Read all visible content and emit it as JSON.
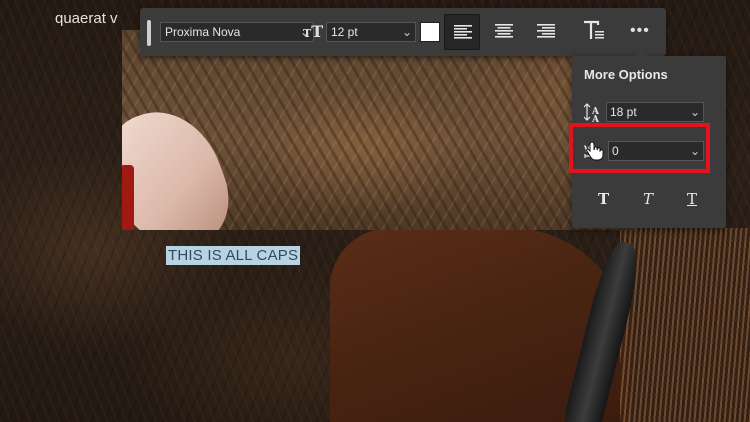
{
  "background": {
    "text_fragment": "quaerat v"
  },
  "canvas": {
    "selected_text": "THIS IS ALL CAPS"
  },
  "toolbar": {
    "font_family": "Proxima Nova",
    "font_size": "12 pt",
    "text_color": "#ffffff",
    "align_left_icon": "align-left-icon",
    "align_center_icon": "align-center-icon",
    "align_right_icon": "align-right-icon",
    "toggle_panel_icon": "text-options-icon",
    "more_icon": "ellipsis-icon",
    "more_label": "•••"
  },
  "more_options": {
    "title": "More Options",
    "leading": "18 pt",
    "tracking": "0",
    "style_buttons": [
      {
        "name": "faux-bold",
        "glyph": "T"
      },
      {
        "name": "faux-italic",
        "glyph": "T"
      },
      {
        "name": "underline",
        "glyph": "T"
      }
    ]
  },
  "colors": {
    "highlight": "#e3131c",
    "selection": "#b8d4e4",
    "panel": "#3b3b3b"
  }
}
